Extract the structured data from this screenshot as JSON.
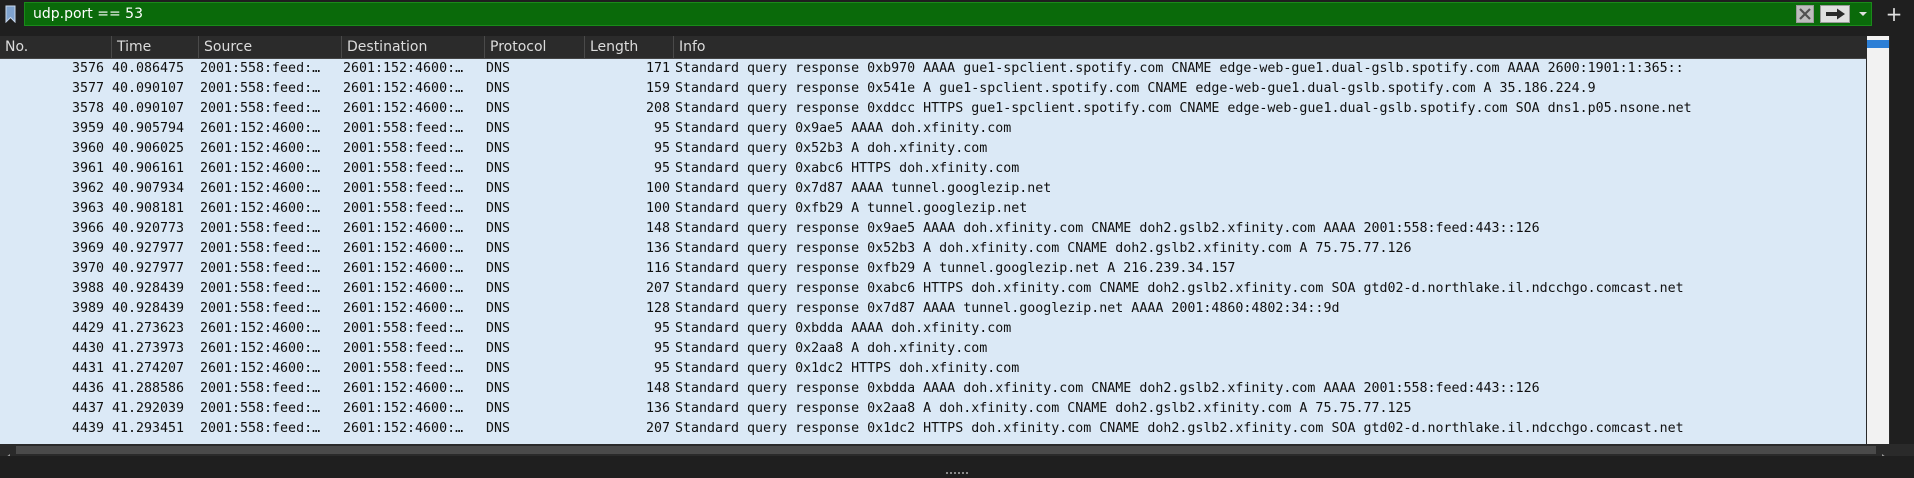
{
  "filter": {
    "value": "udp.port == 53",
    "bookmark_icon": "bookmark-icon",
    "clear_icon": "clear-x-icon",
    "apply_icon": "arrow-right-icon",
    "dropdown_icon": "chevron-down-icon",
    "add_label": "+"
  },
  "colors": {
    "filter_valid": "#0a6a0a",
    "row_bg": "#dbe9f6",
    "header_bg": "#2b2b2b",
    "scroll_thumb": "#2d7fd6"
  },
  "columns": [
    "No.",
    "Time",
    "Source",
    "Destination",
    "Protocol",
    "Length",
    "Info"
  ],
  "rows": [
    {
      "no": "3576",
      "time": "40.086475",
      "src": "2001:558:feed:…",
      "dst": "2601:152:4600:…",
      "proto": "DNS",
      "len": "171",
      "info": "Standard query response 0xb970 AAAA gue1-spclient.spotify.com CNAME edge-web-gue1.dual-gslb.spotify.com AAAA 2600:1901:1:365::"
    },
    {
      "no": "3577",
      "time": "40.090107",
      "src": "2001:558:feed:…",
      "dst": "2601:152:4600:…",
      "proto": "DNS",
      "len": "159",
      "info": "Standard query response 0x541e A gue1-spclient.spotify.com CNAME edge-web-gue1.dual-gslb.spotify.com A 35.186.224.9"
    },
    {
      "no": "3578",
      "time": "40.090107",
      "src": "2001:558:feed:…",
      "dst": "2601:152:4600:…",
      "proto": "DNS",
      "len": "208",
      "info": "Standard query response 0xddcc HTTPS gue1-spclient.spotify.com CNAME edge-web-gue1.dual-gslb.spotify.com SOA dns1.p05.nsone.net"
    },
    {
      "no": "3959",
      "time": "40.905794",
      "src": "2601:152:4600:…",
      "dst": "2001:558:feed:…",
      "proto": "DNS",
      "len": "95",
      "info": "Standard query 0x9ae5 AAAA doh.xfinity.com"
    },
    {
      "no": "3960",
      "time": "40.906025",
      "src": "2601:152:4600:…",
      "dst": "2001:558:feed:…",
      "proto": "DNS",
      "len": "95",
      "info": "Standard query 0x52b3 A doh.xfinity.com"
    },
    {
      "no": "3961",
      "time": "40.906161",
      "src": "2601:152:4600:…",
      "dst": "2001:558:feed:…",
      "proto": "DNS",
      "len": "95",
      "info": "Standard query 0xabc6 HTTPS doh.xfinity.com"
    },
    {
      "no": "3962",
      "time": "40.907934",
      "src": "2601:152:4600:…",
      "dst": "2001:558:feed:…",
      "proto": "DNS",
      "len": "100",
      "info": "Standard query 0x7d87 AAAA tunnel.googlezip.net"
    },
    {
      "no": "3963",
      "time": "40.908181",
      "src": "2601:152:4600:…",
      "dst": "2001:558:feed:…",
      "proto": "DNS",
      "len": "100",
      "info": "Standard query 0xfb29 A tunnel.googlezip.net"
    },
    {
      "no": "3966",
      "time": "40.920773",
      "src": "2001:558:feed:…",
      "dst": "2601:152:4600:…",
      "proto": "DNS",
      "len": "148",
      "info": "Standard query response 0x9ae5 AAAA doh.xfinity.com CNAME doh2.gslb2.xfinity.com AAAA 2001:558:feed:443::126"
    },
    {
      "no": "3969",
      "time": "40.927977",
      "src": "2001:558:feed:…",
      "dst": "2601:152:4600:…",
      "proto": "DNS",
      "len": "136",
      "info": "Standard query response 0x52b3 A doh.xfinity.com CNAME doh2.gslb2.xfinity.com A 75.75.77.126"
    },
    {
      "no": "3970",
      "time": "40.927977",
      "src": "2001:558:feed:…",
      "dst": "2601:152:4600:…",
      "proto": "DNS",
      "len": "116",
      "info": "Standard query response 0xfb29 A tunnel.googlezip.net A 216.239.34.157"
    },
    {
      "no": "3988",
      "time": "40.928439",
      "src": "2001:558:feed:…",
      "dst": "2601:152:4600:…",
      "proto": "DNS",
      "len": "207",
      "info": "Standard query response 0xabc6 HTTPS doh.xfinity.com CNAME doh2.gslb2.xfinity.com SOA gtd02-d.northlake.il.ndcchgo.comcast.net"
    },
    {
      "no": "3989",
      "time": "40.928439",
      "src": "2001:558:feed:…",
      "dst": "2601:152:4600:…",
      "proto": "DNS",
      "len": "128",
      "info": "Standard query response 0x7d87 AAAA tunnel.googlezip.net AAAA 2001:4860:4802:34::9d"
    },
    {
      "no": "4429",
      "time": "41.273623",
      "src": "2601:152:4600:…",
      "dst": "2001:558:feed:…",
      "proto": "DNS",
      "len": "95",
      "info": "Standard query 0xbdda AAAA doh.xfinity.com"
    },
    {
      "no": "4430",
      "time": "41.273973",
      "src": "2601:152:4600:…",
      "dst": "2001:558:feed:…",
      "proto": "DNS",
      "len": "95",
      "info": "Standard query 0x2aa8 A doh.xfinity.com"
    },
    {
      "no": "4431",
      "time": "41.274207",
      "src": "2601:152:4600:…",
      "dst": "2001:558:feed:…",
      "proto": "DNS",
      "len": "95",
      "info": "Standard query 0x1dc2 HTTPS doh.xfinity.com"
    },
    {
      "no": "4436",
      "time": "41.288586",
      "src": "2001:558:feed:…",
      "dst": "2601:152:4600:…",
      "proto": "DNS",
      "len": "148",
      "info": "Standard query response 0xbdda AAAA doh.xfinity.com CNAME doh2.gslb2.xfinity.com AAAA 2001:558:feed:443::126"
    },
    {
      "no": "4437",
      "time": "41.292039",
      "src": "2001:558:feed:…",
      "dst": "2601:152:4600:…",
      "proto": "DNS",
      "len": "136",
      "info": "Standard query response 0x2aa8 A doh.xfinity.com CNAME doh2.gslb2.xfinity.com A 75.75.77.125"
    },
    {
      "no": "4439",
      "time": "41.293451",
      "src": "2001:558:feed:…",
      "dst": "2601:152:4600:…",
      "proto": "DNS",
      "len": "207",
      "info": "Standard query response 0x1dc2 HTTPS doh.xfinity.com CNAME doh2.gslb2.xfinity.com SOA gtd02-d.northlake.il.ndcchgo.comcast.net"
    }
  ]
}
